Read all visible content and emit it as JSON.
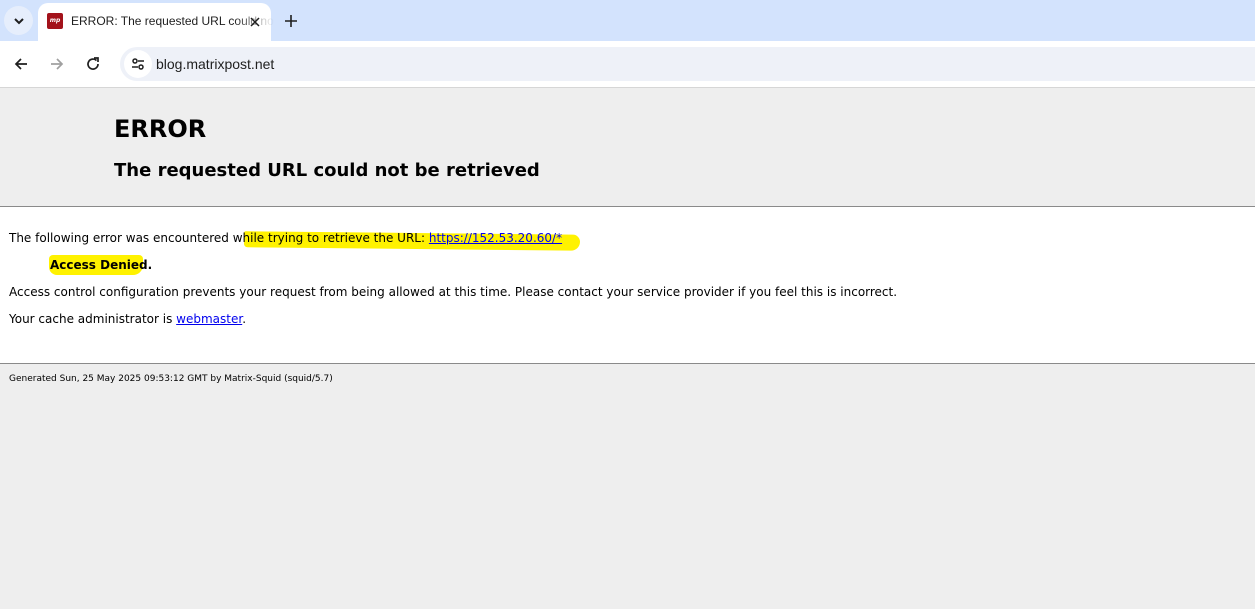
{
  "tab": {
    "title": "ERROR: The requested URL could not be retrieved",
    "favicon_text": "mp"
  },
  "address_bar": {
    "url": "blog.matrixpost.net"
  },
  "error": {
    "heading": "ERROR",
    "subheading": "The requested URL could not be retrieved",
    "intro": "The following error was encountered while trying to retrieve the URL:",
    "url_link": "https://152.53.20.60/*",
    "denied": "Access Denied",
    "denied_suffix": ".",
    "description": "Access control configuration prevents your request from being allowed at this time. Please contact your service provider if you feel this is incorrect.",
    "admin_prefix": "Your cache administrator is",
    "admin_link": "webmaster",
    "admin_suffix": "."
  },
  "footer": {
    "generated": "Generated Sun, 25 May 2025 09:53:12 GMT by Matrix-Squid (squid/5.7)"
  },
  "colors": {
    "highlight": "#fff200",
    "link": "#0000ee",
    "tabstrip": "#d3e3fd",
    "favicon": "#a3121b"
  }
}
